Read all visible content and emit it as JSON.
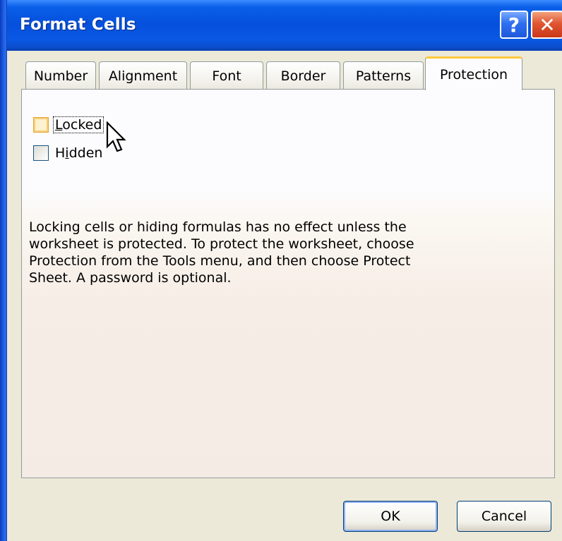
{
  "window": {
    "title": "Format Cells",
    "help_button": "?",
    "close_button": "✕"
  },
  "tabs": [
    {
      "label": "Number",
      "active": false
    },
    {
      "label": "Alignment",
      "active": false
    },
    {
      "label": "Font",
      "active": false
    },
    {
      "label": "Border",
      "active": false
    },
    {
      "label": "Patterns",
      "active": false
    },
    {
      "label": "Protection",
      "active": true
    }
  ],
  "protection": {
    "locked": {
      "label_pre": "",
      "label_mnemonic": "L",
      "label_post": "ocked",
      "checked": false
    },
    "hidden": {
      "label_pre": "H",
      "label_mnemonic": "i",
      "label_post": "dden",
      "checked": false
    },
    "info": "Locking cells or hiding formulas has no effect unless the worksheet is protected. To protect the worksheet, choose Protection from the Tools menu, and then choose Protect Sheet. A password is optional."
  },
  "buttons": {
    "ok": "OK",
    "cancel": "Cancel"
  },
  "icons": {
    "cursor": "arrow-cursor-icon"
  }
}
